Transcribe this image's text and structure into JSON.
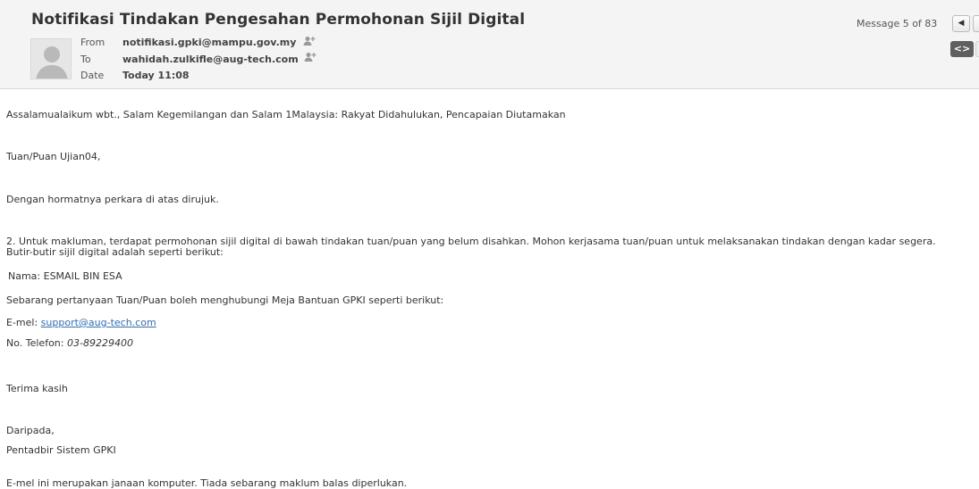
{
  "header": {
    "subject": "Notifikasi Tindakan Pengesahan Permohonan Sijil Digital",
    "from_label": "From",
    "from_value": "notifikasi.gpki@mampu.gov.my",
    "to_label": "To",
    "to_value": "wahidah.zulkifle@aug-tech.com",
    "date_label": "Date",
    "date_value": "Today 11:08",
    "counter": "Message 5 of 83",
    "icons": {
      "prev": "chevron-left-icon",
      "view": "code-view-icon",
      "add_contact": "add-contact-icon"
    }
  },
  "body": {
    "greeting": "Assalamualaikum wbt., Salam Kegemilangan dan Salam 1Malaysia: Rakyat Didahulukan, Pencapaian Diutamakan",
    "salutation": "Tuan/Puan Ujian04,",
    "para1": "Dengan hormatnya perkara di atas dirujuk.",
    "para2_line1": "2.  Untuk makluman, terdapat permohonan sijil digital di bawah tindakan tuan/puan yang belum disahkan. Mohon kerjasama tuan/puan untuk melaksanakan tindakan dengan kadar segera.",
    "para2_line2": "Butir-butir sijil digital adalah seperti berikut:",
    "name_line": "Nama: ESMAIL BIN ESA",
    "contact_intro": "Sebarang pertanyaan Tuan/Puan boleh menghubungi Meja Bantuan GPKI seperti berikut:",
    "email_label": "E-mel: ",
    "email_link": "support@aug-tech.com",
    "phone_label": "No. Telefon: ",
    "phone_value": "03-89229400",
    "thanks": "Terima kasih",
    "from_word": "Daripada,",
    "sender": "Pentadbir Sistem GPKI",
    "footer": "E-mel ini merupakan janaan komputer. Tiada sebarang maklum balas diperlukan."
  }
}
